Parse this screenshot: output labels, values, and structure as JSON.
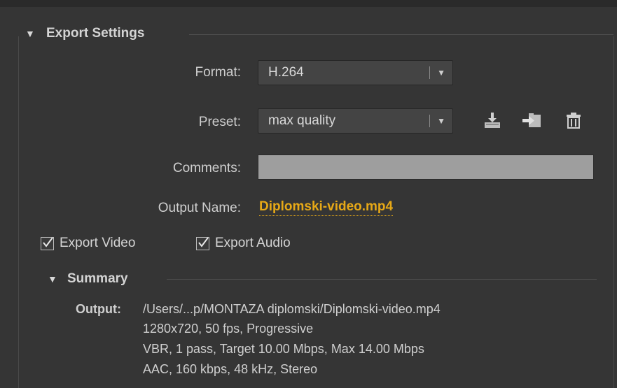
{
  "export_settings": {
    "title": "Export Settings",
    "format": {
      "label": "Format:",
      "value": "H.264"
    },
    "preset": {
      "label": "Preset:",
      "value": "max quality"
    },
    "comments": {
      "label": "Comments:",
      "value": ""
    },
    "output_name": {
      "label": "Output Name:",
      "value": "Diplomski-video.mp4"
    },
    "export_video": {
      "label": "Export Video",
      "checked": true
    },
    "export_audio": {
      "label": "Export Audio",
      "checked": true
    }
  },
  "summary": {
    "title": "Summary",
    "output_label": "Output:",
    "lines": [
      "/Users/...p/MONTAZA diplomski/Diplomski-video.mp4",
      "1280x720, 50 fps, Progressive",
      "VBR, 1 pass, Target 10.00 Mbps, Max 14.00 Mbps",
      "AAC, 160 kbps, 48 kHz, Stereo"
    ]
  },
  "icons": {
    "save_preset": "save-preset-icon",
    "import_preset": "import-preset-icon",
    "delete_preset": "trash-icon"
  },
  "colors": {
    "panel_bg": "#353535",
    "accent_link": "#e6a817",
    "comments_bg": "#9e9e9e"
  }
}
